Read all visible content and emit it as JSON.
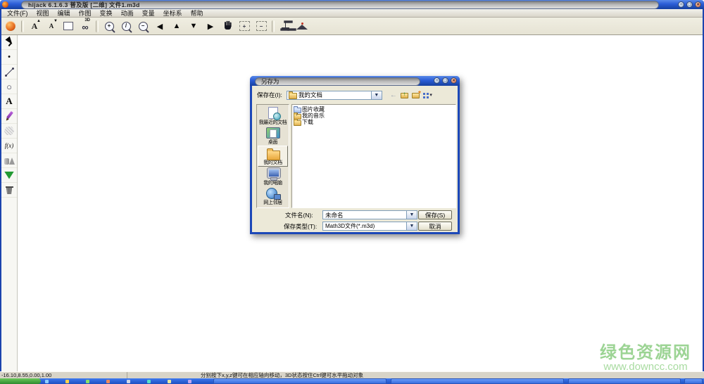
{
  "title_bar": {
    "title": "hijack 6.1.6.3 普及版 [二维] 文件1.m3d",
    "minimize": "−",
    "maximize": "□",
    "close": "×"
  },
  "menu_bar": {
    "items": [
      "文件(F)",
      "视图",
      "编辑",
      "作图",
      "变换",
      "动画",
      "变量",
      "坐标系",
      "帮助"
    ]
  },
  "toolbar": {
    "items": [
      {
        "name": "app-logo-icon",
        "cls": "logo",
        "ia": "false"
      },
      {
        "name": "toolbar-separator",
        "cls": "sep",
        "ia": "false"
      },
      {
        "name": "font-increase-icon",
        "cls": "fontbtn",
        "glyph": "A",
        "badge": "▲"
      },
      {
        "name": "font-decrease-icon",
        "cls": "fontsmall",
        "glyph": "A",
        "badge": "▼"
      },
      {
        "name": "rectangle-tool-icon",
        "cls": "rect"
      },
      {
        "name": "3d-glasses-icon",
        "cls": "glasses",
        "glyph": "∞",
        "badge": "3D"
      },
      {
        "name": "toolbar-separator",
        "cls": "sep",
        "ia": "false"
      },
      {
        "name": "zoom-in-icon",
        "cls": "lens",
        "glyph": "+"
      },
      {
        "name": "zoom-default-icon",
        "cls": "lens",
        "glyph": "/"
      },
      {
        "name": "zoom-out-icon",
        "cls": "lens",
        "glyph": "−"
      },
      {
        "name": "pan-left-icon",
        "cls": "arrow",
        "glyph": "◀"
      },
      {
        "name": "pan-up-icon",
        "cls": "arrow",
        "glyph": "▲"
      },
      {
        "name": "pan-down-icon",
        "cls": "arrow",
        "glyph": "▼"
      },
      {
        "name": "pan-right-icon",
        "cls": "arrow",
        "glyph": "▶"
      },
      {
        "name": "pan-hand-icon",
        "cls": "hand"
      },
      {
        "name": "zoom-region-in-icon",
        "cls": "dashed",
        "glyph": "+"
      },
      {
        "name": "zoom-region-out-icon",
        "cls": "dashed",
        "glyph": "−"
      },
      {
        "name": "toolbar-separator",
        "cls": "sep",
        "ia": "false"
      },
      {
        "name": "coordinate-system-icon",
        "cls": "axis"
      },
      {
        "name": "cap-icon",
        "cls": "cap"
      }
    ]
  },
  "palette": {
    "tools": [
      {
        "name": "select-tool-icon",
        "cls": "cursorA"
      },
      {
        "name": "point-tool-icon",
        "cls": "point",
        "glyph": "•"
      },
      {
        "name": "segment-tool-icon",
        "cls": "segment"
      },
      {
        "name": "circle-tool-icon",
        "cls": "circleT",
        "glyph": "○"
      },
      {
        "name": "text-tool-icon",
        "cls": "textT",
        "glyph": "A"
      },
      {
        "name": "pencil-tool-icon",
        "cls": "pencil"
      },
      {
        "name": "polygon-tool-icon",
        "cls": "hexagon"
      },
      {
        "name": "function-tool-icon",
        "cls": "fx",
        "glyph": "f(x)"
      },
      {
        "name": "solids-tool-icon",
        "cls": "solids"
      },
      {
        "name": "colors-tool-icon",
        "cls": "fan"
      },
      {
        "name": "delete-tool-icon",
        "cls": "trash"
      }
    ]
  },
  "dialog": {
    "title": "另存为",
    "minimize": "−",
    "maximize": "□",
    "close": "×",
    "save_in": {
      "label": "保存在(I):",
      "value": "我的文档",
      "dropdown": "▼"
    },
    "nav_icons": [
      {
        "name": "back-icon",
        "cls": "back",
        "glyph": "←"
      },
      {
        "name": "up-folder-icon",
        "cls": "upf"
      },
      {
        "name": "new-folder-icon",
        "cls": "newf"
      },
      {
        "name": "view-menu-icon",
        "cls": "views",
        "glyph": "▾"
      }
    ],
    "places": [
      {
        "label": "我最近的文档",
        "icon": "recent-documents-icon",
        "cls": "recent"
      },
      {
        "label": "桌面",
        "icon": "desktop-icon",
        "cls": "desktop"
      },
      {
        "label": "我的文档",
        "icon": "my-documents-icon",
        "cls": "mydocs",
        "sel": "selected"
      },
      {
        "label": "我的电脑",
        "icon": "my-computer-icon",
        "cls": "mycomp"
      },
      {
        "label": "网上邻居",
        "icon": "network-icon",
        "cls": "network"
      }
    ],
    "files": [
      {
        "label": "图片收藏",
        "icon": "pictures-folder-icon",
        "cls": "pics"
      },
      {
        "label": "我的音乐",
        "icon": "music-folder-icon",
        "cls": "music",
        "note": "♪"
      },
      {
        "label": "下载",
        "icon": "folder-icon",
        "cls": "plain"
      }
    ],
    "file_name": {
      "label": "文件名(N):",
      "value": "未命名",
      "dropdown": "▼"
    },
    "file_type": {
      "label": "保存类型(T):",
      "value": "Math3D文件(*.m3d)",
      "dropdown": "▼"
    },
    "buttons": {
      "save": "保存(S)",
      "cancel": "取消"
    }
  },
  "status_bar": {
    "coordinates": "-16.10,8.55,0.00,1.00",
    "hint": "分别按下x,y,z键可在相应轴向移动，3D状态按住Ctrl键可水平拖动对象"
  },
  "watermark": {
    "line1": "绿色资源网",
    "line2": "www.downcc.com"
  },
  "colors": {
    "titlebar_blue": "#2a5cd6",
    "dialog_bg": "#ece9d8",
    "taskbar_blue": "#2a63e0",
    "start_green": "#2d8a2f",
    "watermark_green": "#9cd494"
  }
}
